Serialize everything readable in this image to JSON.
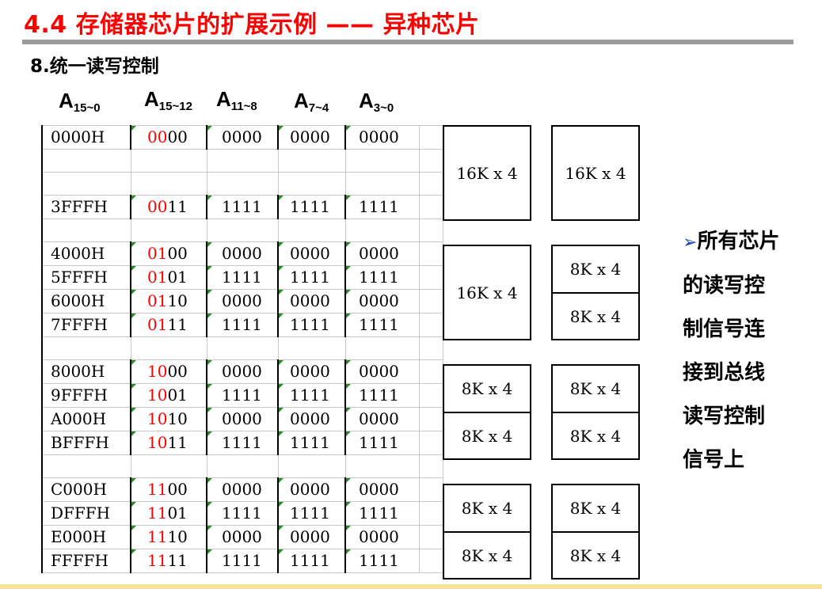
{
  "title": "4.4 存储器芯片的扩展示例 —— 异种芯片",
  "subtitle": "8.统一读写控制",
  "headers": [
    {
      "base": "A",
      "sub": "15~0"
    },
    {
      "base": "A",
      "sub": "15~12"
    },
    {
      "base": "A",
      "sub": "11~8"
    },
    {
      "base": "A",
      "sub": "7~4"
    },
    {
      "base": "A",
      "sub": "3~0"
    }
  ],
  "rows": [
    {
      "addr": "0000H",
      "hi": "00",
      "lo": "00",
      "a118": "0000",
      "a74": "0000",
      "a30": "0000"
    },
    {},
    {},
    {
      "addr": "3FFFH",
      "hi": "00",
      "lo": "11",
      "a118": "1111",
      "a74": "1111",
      "a30": "1111"
    },
    {},
    {
      "addr": "4000H",
      "hi": "01",
      "lo": "00",
      "a118": "0000",
      "a74": "0000",
      "a30": "0000"
    },
    {
      "addr": "5FFFH",
      "hi": "01",
      "lo": "01",
      "a118": "1111",
      "a74": "1111",
      "a30": "1111"
    },
    {
      "addr": "6000H",
      "hi": "01",
      "lo": "10",
      "a118": "0000",
      "a74": "0000",
      "a30": "0000"
    },
    {
      "addr": "7FFFH",
      "hi": "01",
      "lo": "11",
      "a118": "1111",
      "a74": "1111",
      "a30": "1111"
    },
    {},
    {
      "addr": "8000H",
      "hi": "10",
      "lo": "00",
      "a118": "0000",
      "a74": "0000",
      "a30": "0000"
    },
    {
      "addr": "9FFFH",
      "hi": "10",
      "lo": "01",
      "a118": "1111",
      "a74": "1111",
      "a30": "1111"
    },
    {
      "addr": "A000H",
      "hi": "10",
      "lo": "10",
      "a118": "0000",
      "a74": "0000",
      "a30": "0000"
    },
    {
      "addr": "BFFFH",
      "hi": "10",
      "lo": "11",
      "a118": "1111",
      "a74": "1111",
      "a30": "1111"
    },
    {},
    {
      "addr": "C000H",
      "hi": "11",
      "lo": "00",
      "a118": "0000",
      "a74": "0000",
      "a30": "0000"
    },
    {
      "addr": "DFFFH",
      "hi": "11",
      "lo": "01",
      "a118": "1111",
      "a74": "1111",
      "a30": "1111"
    },
    {
      "addr": "E000H",
      "hi": "11",
      "lo": "10",
      "a118": "0000",
      "a74": "0000",
      "a30": "0000"
    },
    {
      "addr": "FFFFH",
      "hi": "11",
      "lo": "11",
      "a118": "1111",
      "a74": "1111",
      "a30": "1111"
    }
  ],
  "chips": {
    "big1a": "16K x 4",
    "big1b": "16K x 4",
    "big2": "16K x 4",
    "small2a": "8K x 4",
    "small2b": "8K x 4",
    "g3a": "8K x 4",
    "g3b": "8K x 4",
    "g3c": "8K x 4",
    "g3d": "8K x 4",
    "g4a": "8K x 4",
    "g4b": "8K x 4",
    "g4c": "8K x 4",
    "g4d": "8K x 4"
  },
  "note": {
    "bullet": "➢",
    "lines": [
      "所有芯片",
      "的读写控",
      "制信号连",
      "接到总线",
      "读写控制",
      "信号上"
    ]
  },
  "colors": {
    "title": "#ff0000",
    "highlight": "#ff0000",
    "rule": "#9b9b9b",
    "bullet": "#1a3fb8"
  }
}
